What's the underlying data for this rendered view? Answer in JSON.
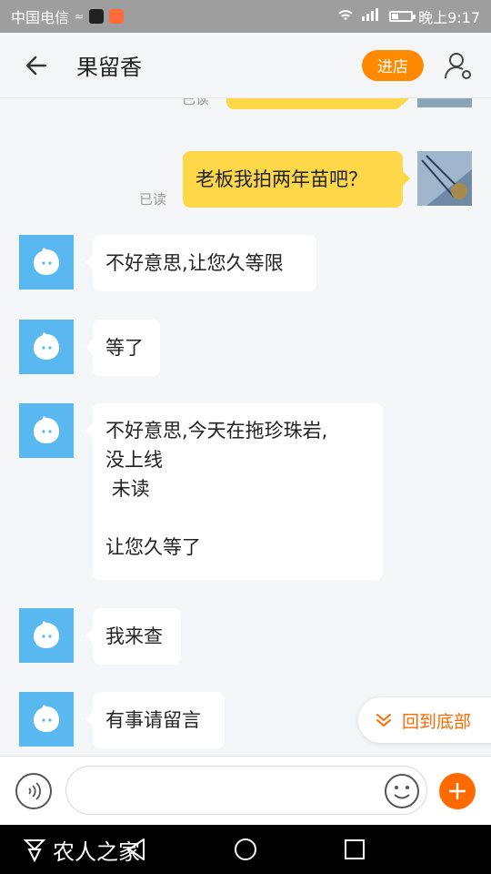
{
  "status_bar": {
    "carrier": "中国电信",
    "time": "晚上9:17",
    "battery_level": 0.3
  },
  "header": {
    "title": "果留香",
    "shop_label": "进店"
  },
  "messages": {
    "partial_read": "已读",
    "out1": {
      "text": "老板我拍两年苗吧？",
      "status": "已读"
    },
    "in1": "不好意思,让您久等限",
    "in2": "等了",
    "in3": "不好意思,今天在拖珍珠岩,\n没上线\n 未读\n\n让您久等了",
    "in4": "我来查",
    "in5": "有事请留言"
  },
  "scroll_bottom_label": "回到底部",
  "input": {
    "value": "",
    "placeholder": ""
  },
  "watermark": "农人之家",
  "colors": {
    "accent": "#ff6a00",
    "bubble_out": "#ffd84a",
    "bot_avatar": "#5ab8f0"
  },
  "icons": [
    "back-arrow-icon",
    "person-settings-icon",
    "bot-face-icon",
    "chevron-down-icon",
    "voice-icon",
    "emoji-icon",
    "plus-icon",
    "nav-back-icon",
    "nav-home-icon",
    "nav-recents-icon"
  ]
}
